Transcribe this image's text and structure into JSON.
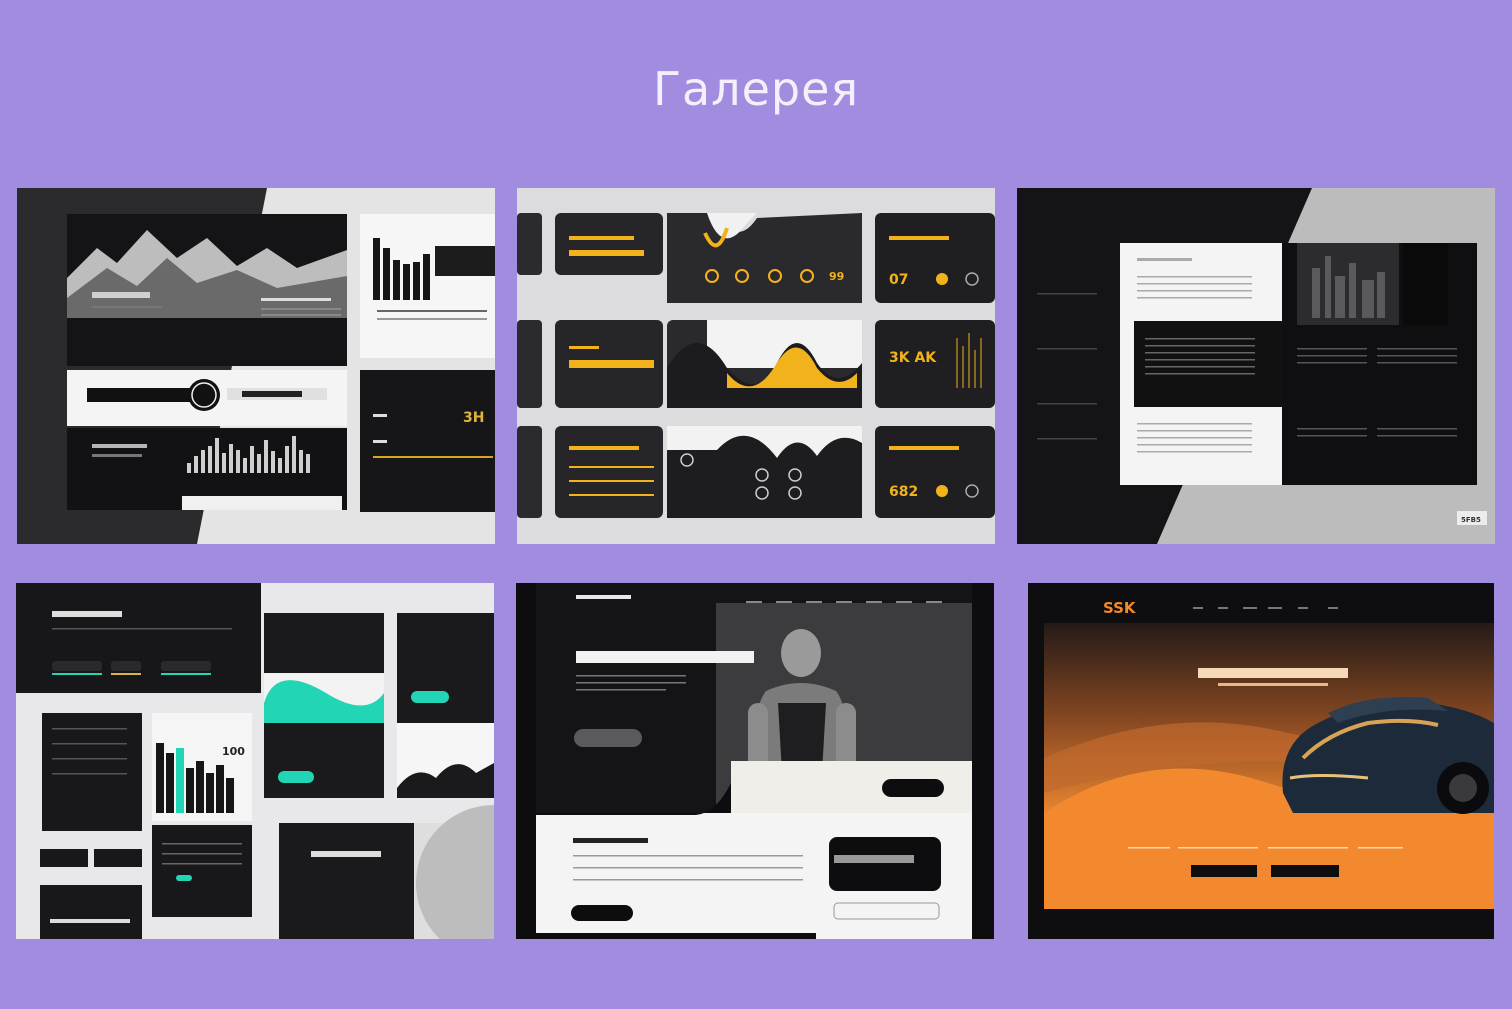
{
  "page": {
    "title": "Галерея"
  },
  "gallery": {
    "items": [
      {
        "id": "mockup-1",
        "theme": "monochrome-dashboard",
        "glyph": "3H"
      },
      {
        "id": "mockup-2",
        "theme": "dark-yellow-cards",
        "glyphs": [
          "07",
          "3K AK",
          "682",
          "99"
        ]
      },
      {
        "id": "mockup-3",
        "theme": "monochrome-editorial",
        "glyph": "5FB5"
      },
      {
        "id": "mockup-4",
        "theme": "dark-teal-dashboard",
        "glyph": "100"
      },
      {
        "id": "mockup-5",
        "theme": "fitness-landing"
      },
      {
        "id": "mockup-6",
        "theme": "car-landing-orange",
        "logo": "SSK"
      }
    ]
  },
  "colors": {
    "background": "#a18ce0",
    "yellow_accent": "#f2b21c",
    "teal_accent": "#22d6b5",
    "orange_accent": "#f08a2a",
    "dark": "#1a1a1e"
  }
}
